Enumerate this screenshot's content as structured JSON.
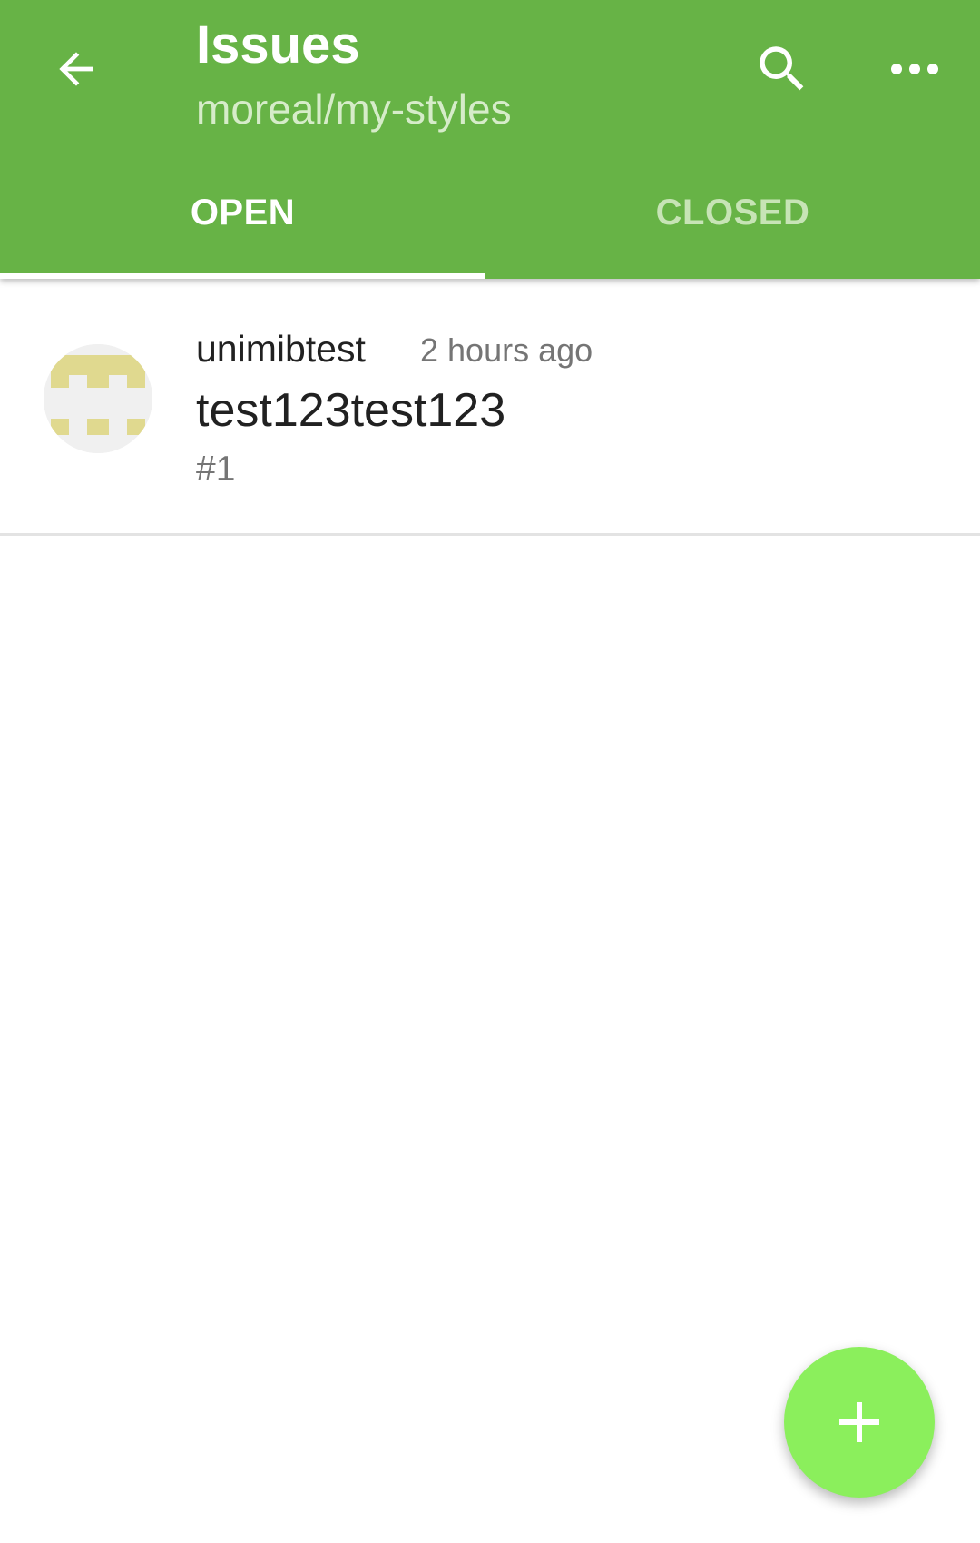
{
  "colors": {
    "app_bar": "#67b346",
    "subtitle": "#d6ecc9",
    "tab_inactive": "#c7e4b6",
    "fab": "#8bef5c",
    "avatar_pattern": "#e0d98f",
    "avatar_bg": "#f0f0f0"
  },
  "header": {
    "back_icon": "arrow-left-icon",
    "title": "Issues",
    "subtitle": "moreal/my-styles",
    "search_icon": "search-icon",
    "more_icon": "more-horizontal-icon"
  },
  "tabs": [
    {
      "label": "OPEN",
      "selected": true
    },
    {
      "label": "CLOSED",
      "selected": false
    }
  ],
  "issues": [
    {
      "author": "unimibtest",
      "time": "2 hours ago",
      "title": "test123test123",
      "number": "#1",
      "avatar_icon": "identicon-avatar"
    }
  ],
  "fab": {
    "icon": "plus-icon"
  }
}
